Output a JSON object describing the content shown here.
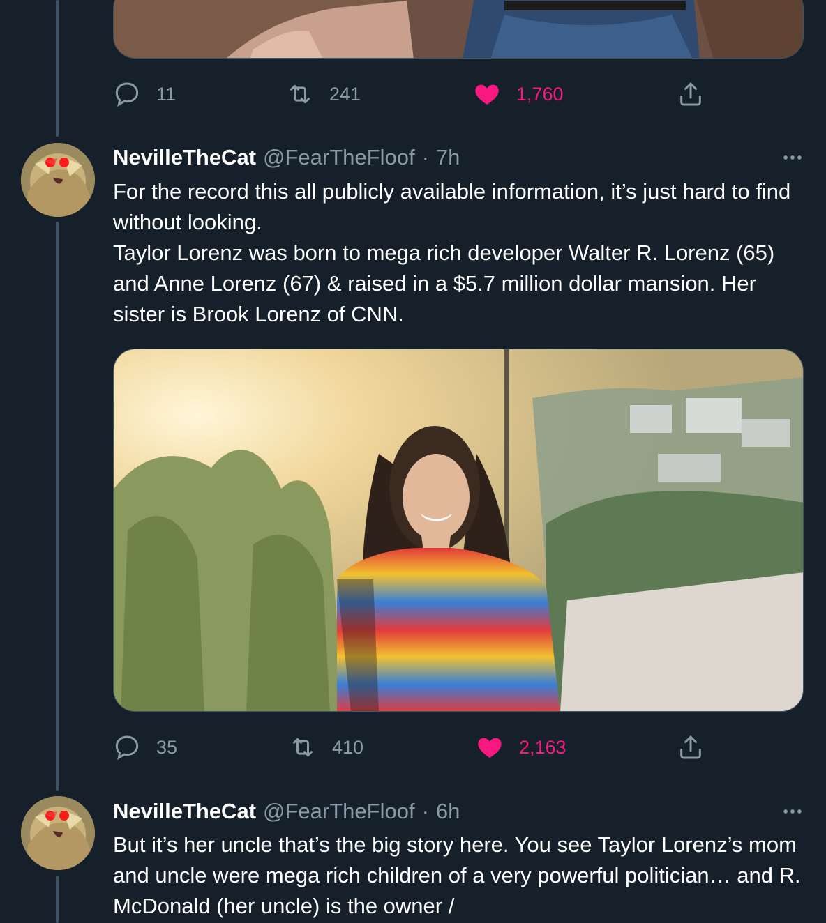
{
  "tweets": [
    {
      "stats": {
        "replies": "11",
        "retweets": "241",
        "likes": "1,760"
      }
    },
    {
      "author": {
        "name": "NevilleTheCat",
        "handle": "@FearTheFloof",
        "separator": "·",
        "time": "7h"
      },
      "text": "For the record this all publicly available information, it’s just hard to find without looking.\nTaylor Lorenz was born to mega rich developer Walter R. Lorenz (65) and Anne Lorenz (67) & raised in a $5.7 million dollar mansion. Her sister is Brook Lorenz of CNN.",
      "stats": {
        "replies": "35",
        "retweets": "410",
        "likes": "2,163"
      }
    },
    {
      "author": {
        "name": "NevilleTheCat",
        "handle": "@FearTheFloof",
        "separator": "·",
        "time": "6h"
      },
      "text": "But it’s her uncle that’s the big story here. You see Taylor Lorenz’s mom and uncle were mega rich children of a very powerful politician… and R. McDonald (her uncle) is the owner /"
    }
  ],
  "colors": {
    "background": "#15202b",
    "secondary_text": "#8b98a5",
    "like_pink": "#f91880",
    "thread_line": "#3d5466"
  },
  "icons": {
    "reply": "reply-icon",
    "retweet": "retweet-icon",
    "like": "heart-icon",
    "share": "share-icon",
    "more": "more-icon"
  }
}
